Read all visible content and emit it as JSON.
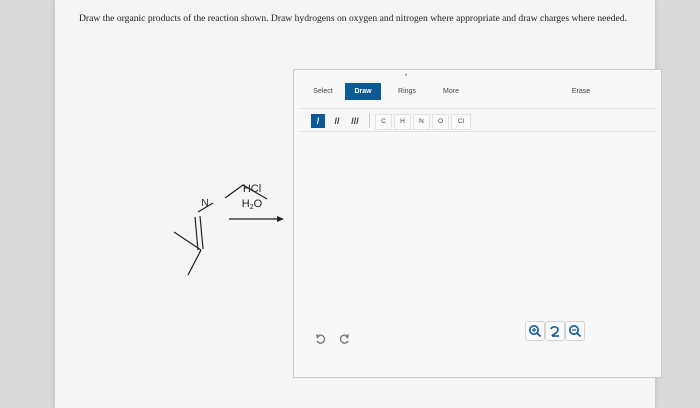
{
  "question": {
    "text": "Draw the organic products of the reaction shown. Draw hydrogens on oxygen and nitrogen where appropriate and draw charges where needed."
  },
  "reaction": {
    "atom_label": "N",
    "reagent_1": "HCl",
    "reagent_2_main": "H",
    "reagent_2_sub": "2",
    "reagent_2_tail": "O"
  },
  "editor": {
    "tabs": {
      "select": "Select",
      "draw": "Draw",
      "rings": "Rings",
      "more": "More",
      "erase": "Erase"
    },
    "bond_tools": [
      "/",
      "//",
      "///"
    ],
    "atoms": [
      "C",
      "H",
      "N",
      "O",
      "Cl"
    ],
    "undo_icon": "undo-icon",
    "redo_icon": "redo-icon",
    "accent_color": "#0c5a96"
  }
}
